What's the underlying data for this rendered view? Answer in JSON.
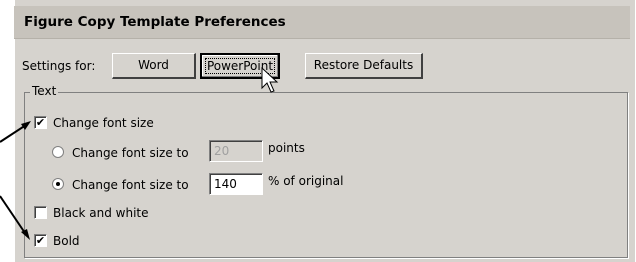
{
  "header": {
    "title": "Figure Copy Template Preferences"
  },
  "settings": {
    "label": "Settings for:",
    "buttons": {
      "word": "Word",
      "powerpoint": "PowerPoint",
      "restore": "Restore Defaults"
    },
    "selected": "PowerPoint"
  },
  "text_group": {
    "legend": "Text",
    "change_font_size": {
      "label": "Change font size",
      "checked": true
    },
    "option_points": {
      "label": "Change font size to",
      "value": "20",
      "unit": "points",
      "selected": false,
      "enabled": false
    },
    "option_percent": {
      "label": "Change font size to",
      "value": "140",
      "unit": "% of original",
      "selected": true,
      "enabled": true
    },
    "black_and_white": {
      "label": "Black and white",
      "checked": false
    },
    "bold": {
      "label": "Bold",
      "checked": true
    }
  },
  "annotation": {
    "arrow_count": 2,
    "color": "#000000"
  }
}
